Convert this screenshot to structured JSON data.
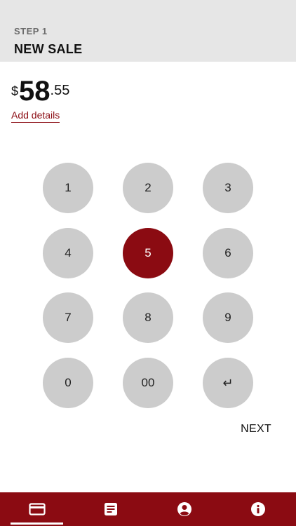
{
  "header": {
    "step_label": "STEP 1",
    "title": "NEW SALE"
  },
  "amount": {
    "currency": "$",
    "whole": "58",
    "cents": ".55"
  },
  "add_details_label": "Add details",
  "keypad": {
    "keys": [
      "1",
      "2",
      "3",
      "4",
      "5",
      "6",
      "7",
      "8",
      "9",
      "0",
      "00",
      "↵"
    ],
    "active_key": "5"
  },
  "next_label": "NEXT",
  "tabbar": {
    "tabs": [
      {
        "name": "payment",
        "icon": "credit-card-icon"
      },
      {
        "name": "receipts",
        "icon": "document-icon"
      },
      {
        "name": "account",
        "icon": "user-circle-icon"
      },
      {
        "name": "info",
        "icon": "info-icon"
      }
    ],
    "active_tab": "payment"
  },
  "colors": {
    "accent": "#8b0b12",
    "key": "#cccccc",
    "header": "#e6e6e6"
  }
}
